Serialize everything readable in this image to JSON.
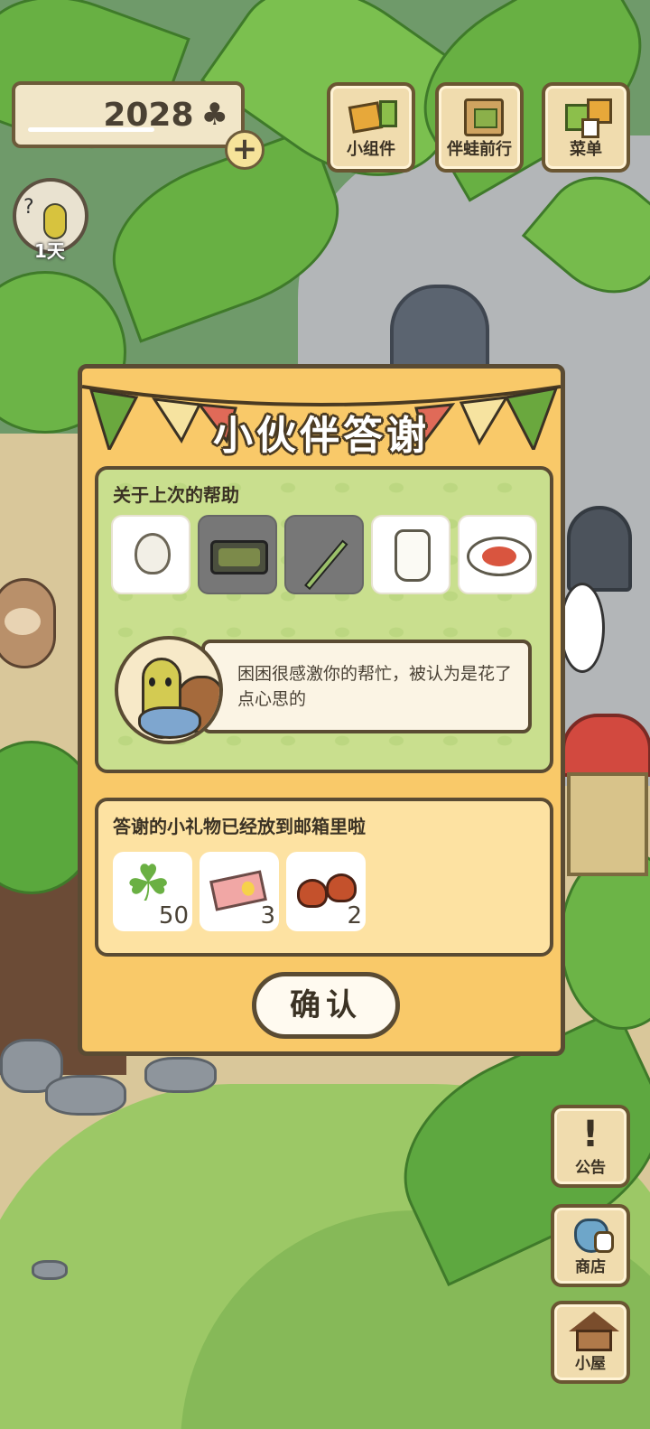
{
  "hud": {
    "clover_count": "2028",
    "clover_icon": "clover-icon",
    "plus_label": "+",
    "day_label": "1天"
  },
  "top_buttons": [
    {
      "label": "小组件",
      "icon": "widget-icon"
    },
    {
      "label": "伴蛙前行",
      "icon": "album-icon"
    },
    {
      "label": "菜单",
      "icon": "menu-icon"
    }
  ],
  "side_buttons": [
    {
      "label": "公告",
      "icon": "exclamation-icon",
      "glyph": "!"
    },
    {
      "label": "商店",
      "icon": "shop-bag-icon"
    },
    {
      "label": "小屋",
      "icon": "house-icon"
    }
  ],
  "dialog": {
    "title": "小伙伴答谢",
    "help_section": {
      "heading": "关于上次的帮助",
      "items": [
        {
          "name": "garlic",
          "dimmed": false
        },
        {
          "name": "bento",
          "dimmed": true
        },
        {
          "name": "green-onion",
          "dimmed": true
        },
        {
          "name": "milk-jug",
          "dimmed": false
        },
        {
          "name": "salad-plate",
          "dimmed": false
        }
      ],
      "message": "困困很感激你的帮忙，被认为是花了点心思的"
    },
    "gift_section": {
      "heading": "答谢的小礼物已经放到邮箱里啦",
      "gifts": [
        {
          "name": "clover",
          "qty": "50"
        },
        {
          "name": "ticket",
          "qty": "3"
        },
        {
          "name": "chestnut",
          "qty": "2"
        }
      ]
    },
    "confirm_label": "确认"
  },
  "colors": {
    "dialog_bg": "#f9c969",
    "help_panel_bg": "#c9df8e",
    "gift_panel_bg": "#fde2a2",
    "outline": "#5a4b33"
  }
}
